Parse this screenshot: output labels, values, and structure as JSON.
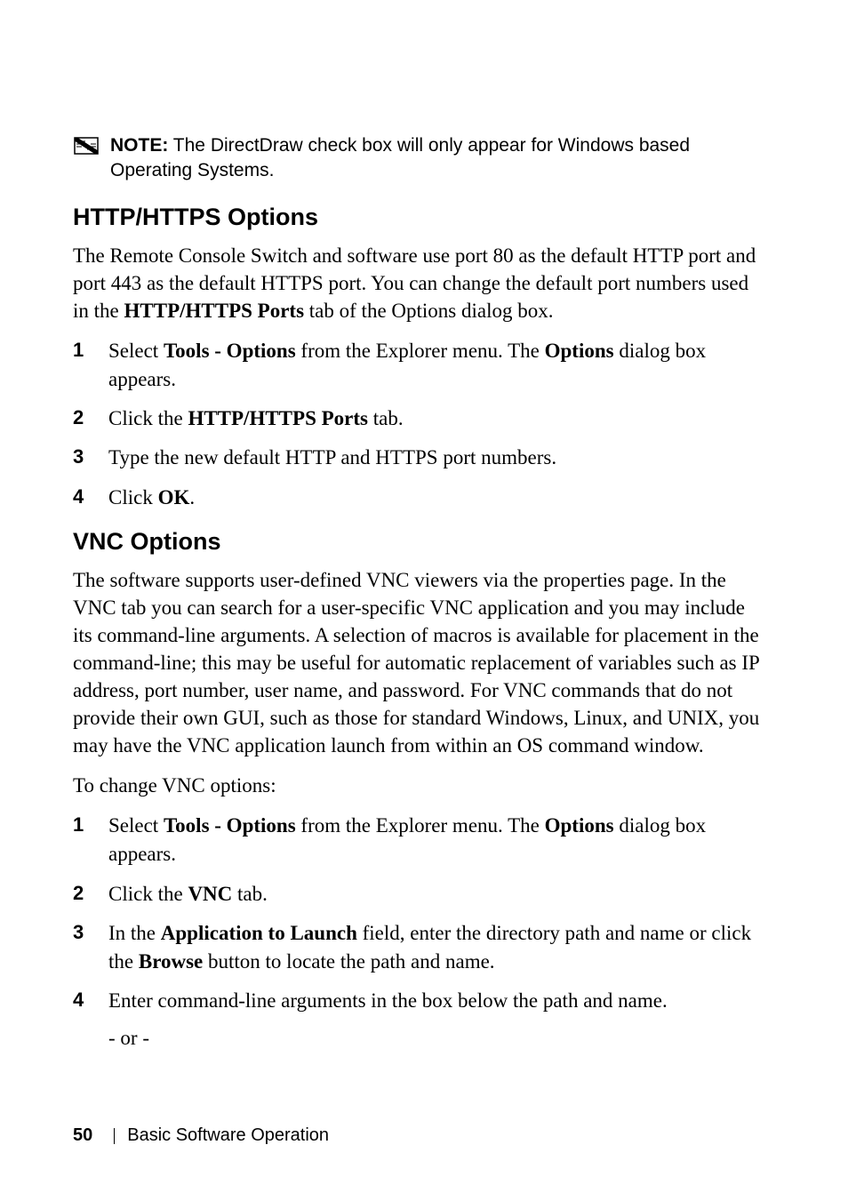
{
  "note": {
    "label": "NOTE:",
    "text": "The DirectDraw check box will only appear for Windows based Operating Systems."
  },
  "section1": {
    "heading": "HTTP/HTTPS Options",
    "intro_pre": "The Remote Console Switch and software use port 80 as the default HTTP port and port 443 as the default HTTPS port. You can change the default port numbers used in the ",
    "intro_bold": "HTTP/HTTPS Ports",
    "intro_post": " tab of the Options dialog box.",
    "steps": {
      "s1_pre": "Select ",
      "s1_b1": "Tools - Options",
      "s1_mid": " from the Explorer menu. The ",
      "s1_b2": "Options",
      "s1_post": " dialog box appears.",
      "s2_pre": "Click the ",
      "s2_b": "HTTP/HTTPS Ports",
      "s2_post": " tab.",
      "s3": "Type the new default HTTP and HTTPS port numbers.",
      "s4_pre": "Click ",
      "s4_b": "OK",
      "s4_post": "."
    }
  },
  "section2": {
    "heading": "VNC Options",
    "intro": "The software supports user-defined VNC viewers via the properties page. In the VNC tab you can search for a user-specific VNC application and you may include its command-line arguments. A selection of macros is available for placement in the command-line; this may be useful for automatic replacement of variables such as IP address, port number, user name, and password. For VNC commands that do not provide their own GUI, such as those for standard Windows, Linux, and UNIX, you may have the VNC application launch from within an OS command window.",
    "lead": "To change VNC options:",
    "steps": {
      "s1_pre": "Select ",
      "s1_b1": "Tools - Options",
      "s1_mid": " from the Explorer menu. The ",
      "s1_b2": "Options",
      "s1_post": " dialog box appears.",
      "s2_pre": "Click the ",
      "s2_b": "VNC",
      "s2_post": " tab.",
      "s3_pre": "In the ",
      "s3_b1": "Application to Launch",
      "s3_mid": " field, enter the directory path and name or click the ",
      "s3_b2": "Browse",
      "s3_post": " button to locate the path and name.",
      "s4": "Enter command-line arguments in the box below the path and name.",
      "or": "- or -"
    }
  },
  "footer": {
    "page": "50",
    "title": "Basic Software Operation"
  }
}
